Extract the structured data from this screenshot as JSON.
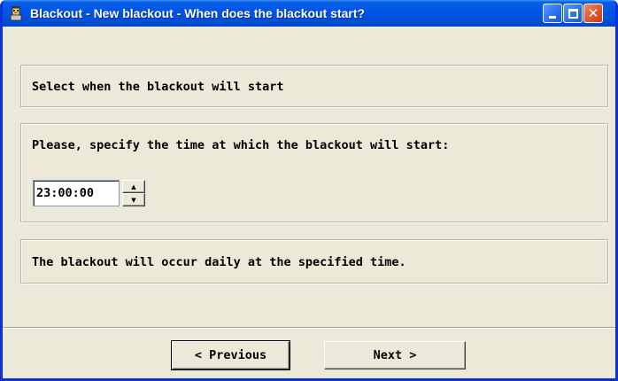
{
  "window": {
    "title": "Blackout - New blackout - When does the blackout start?",
    "app_icon": "blackout-app-icon",
    "controls": {
      "minimize_icon": "minimize-icon",
      "maximize_icon": "maximize-icon",
      "close_glyph": "✕"
    }
  },
  "main": {
    "header_text": "Select when the blackout will start",
    "time_prompt": "Please, specify the time at which the blackout will start:",
    "time_value": "23:00:00",
    "spin_up_glyph": "▲",
    "spin_down_glyph": "▼",
    "info_text": "The blackout will occur daily at the specified time."
  },
  "footer": {
    "previous_label": "< Previous",
    "next_label": "Next >"
  },
  "colors": {
    "dialog_background": "#ece9d8",
    "titlebar_blue": "#0055e5",
    "close_red": "#e05a30"
  }
}
